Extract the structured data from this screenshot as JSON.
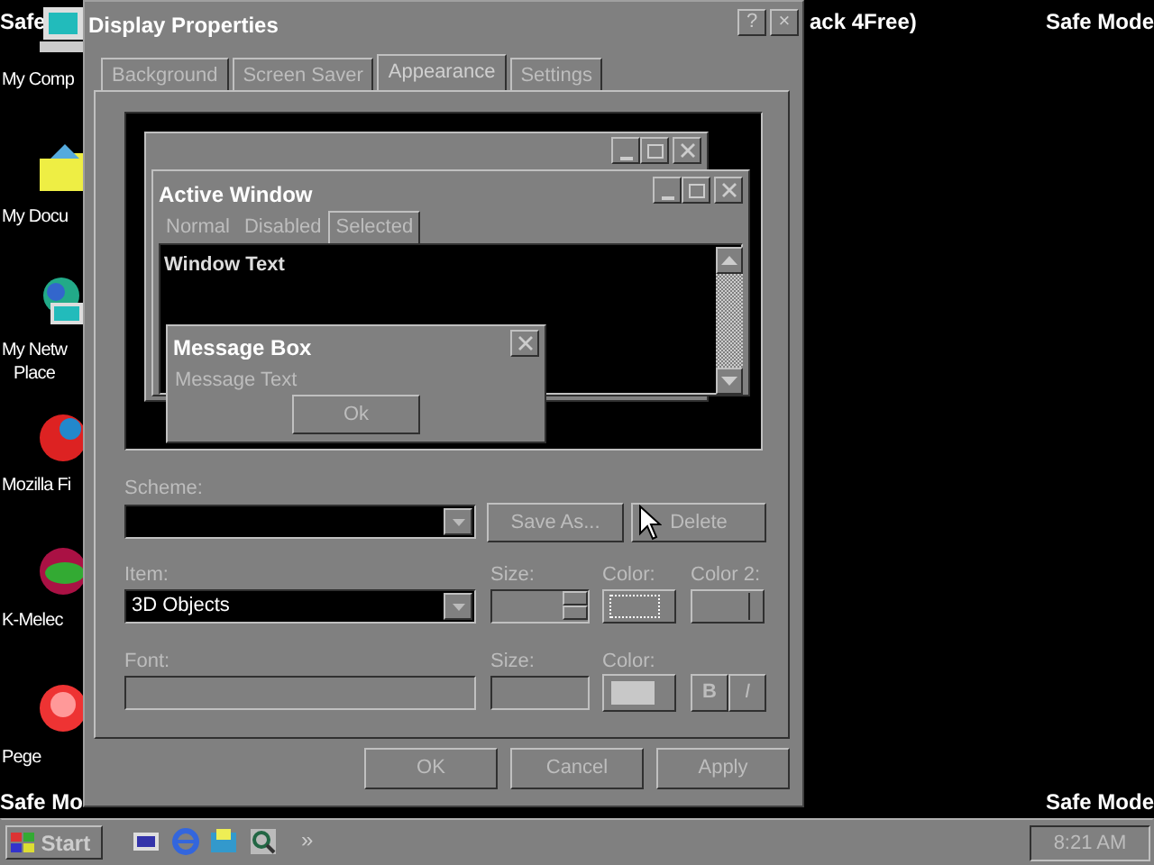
{
  "desktop_texts": [
    {
      "text": "Safe",
      "kind": "top-left"
    },
    {
      "text": "ack 4Free)",
      "kind": "top-middle"
    },
    {
      "text": "Safe Mode",
      "kind": "top-right"
    },
    {
      "text": "Safe Mo",
      "kind": "bottom-left"
    },
    {
      "text": "Safe Mode",
      "kind": "bottom-right"
    }
  ],
  "desktop_icons": [
    {
      "label": "My Comp",
      "kind": "computer"
    },
    {
      "label": "My Docu",
      "kind": "folder"
    },
    {
      "label": "My Netw\nPlace",
      "kind": "network"
    },
    {
      "label": "Mozilla Fi",
      "kind": "globe"
    },
    {
      "label": "K-Melec",
      "kind": "chameleon"
    },
    {
      "label": "Pege",
      "kind": "mail"
    }
  ],
  "dialog": {
    "title": "Display Properties",
    "help": "?",
    "close": "×",
    "tabs": [
      {
        "label": "Background",
        "selected": false
      },
      {
        "label": "Screen Saver",
        "selected": false
      },
      {
        "label": "Appearance",
        "selected": true
      },
      {
        "label": "Settings",
        "selected": false
      }
    ],
    "preview": {
      "active_window": {
        "title": "Active Window",
        "menu": [
          {
            "label": "Normal",
            "selected": false
          },
          {
            "label": "Disabled",
            "selected": false
          },
          {
            "label": "Selected",
            "selected": true
          }
        ],
        "window_text": "Window Text"
      },
      "message_box": {
        "title": "Message Box",
        "text": "Message Text",
        "button": "Ok"
      }
    },
    "scheme": {
      "label": "Scheme:",
      "save_as": "Save As...",
      "delete": "Delete"
    },
    "item": {
      "label": "Item:",
      "value": "3D Objects",
      "size_label": "Size:",
      "color_label": "Color:",
      "color2_label": "Color 2:"
    },
    "font": {
      "label": "Font:",
      "size_label": "Size:",
      "color_label": "Color:",
      "bold": "B",
      "italic": "I"
    },
    "buttons": [
      "OK",
      "Cancel",
      "Apply"
    ]
  },
  "taskbar": {
    "start": "Start",
    "chevron": "»",
    "clock": "8:21 AM"
  }
}
